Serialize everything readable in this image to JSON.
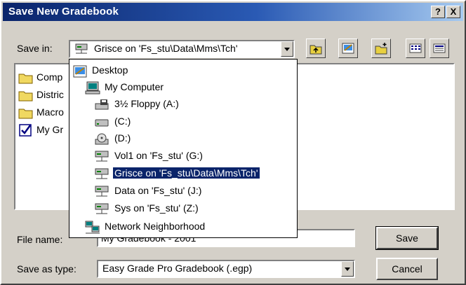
{
  "dialog": {
    "title": "Save New Gradebook",
    "help_button": "?",
    "close_button": "X"
  },
  "save_in": {
    "label": "Save in:",
    "value": "Grisce on 'Fs_stu\\Data\\Mms\\Tch'"
  },
  "toolbar": {
    "icons": [
      "up-folder-icon",
      "desktop-icon",
      "new-folder-icon",
      "list-view-icon",
      "details-view-icon"
    ]
  },
  "file_list": {
    "items": [
      {
        "label": "Comp",
        "icon": "folder-icon"
      },
      {
        "label": "Distric",
        "icon": "folder-icon"
      },
      {
        "label": "Macro",
        "icon": "folder-icon"
      },
      {
        "label": "My Gr",
        "icon": "gradebook-icon"
      }
    ]
  },
  "location_dropdown": {
    "items": [
      {
        "label": "Desktop",
        "icon": "desktop-icon",
        "indent": 0
      },
      {
        "label": "My Computer",
        "icon": "computer-icon",
        "indent": 1
      },
      {
        "label": "3½ Floppy (A:)",
        "icon": "floppy-drive-icon",
        "indent": 2
      },
      {
        "label": "(C:)",
        "icon": "hard-drive-icon",
        "indent": 2
      },
      {
        "label": "(D:)",
        "icon": "cd-drive-icon",
        "indent": 2
      },
      {
        "label": "Vol1 on 'Fs_stu' (G:)",
        "icon": "network-drive-icon",
        "indent": 2
      },
      {
        "label": "Grisce on 'Fs_stu\\Data\\Mms\\Tch'",
        "icon": "network-drive-icon",
        "indent": 2,
        "selected": true
      },
      {
        "label": "Data on 'Fs_stu' (J:)",
        "icon": "network-drive-icon",
        "indent": 2
      },
      {
        "label": "Sys on 'Fs_stu' (Z:)",
        "icon": "network-drive-icon",
        "indent": 2
      },
      {
        "label": "Network Neighborhood",
        "icon": "network-neighborhood-icon",
        "indent": 1
      }
    ]
  },
  "file_name": {
    "label": "File name:",
    "value": "My Gradebook - 2001"
  },
  "save_as_type": {
    "label": "Save as type:",
    "value": "Easy Grade Pro Gradebook (.egp)"
  },
  "buttons": {
    "save": "Save",
    "cancel": "Cancel"
  },
  "colors": {
    "titlebar_start": "#0a246a",
    "titlebar_end": "#a6caf0",
    "selection": "#0a246a",
    "face": "#d4d0c8"
  }
}
